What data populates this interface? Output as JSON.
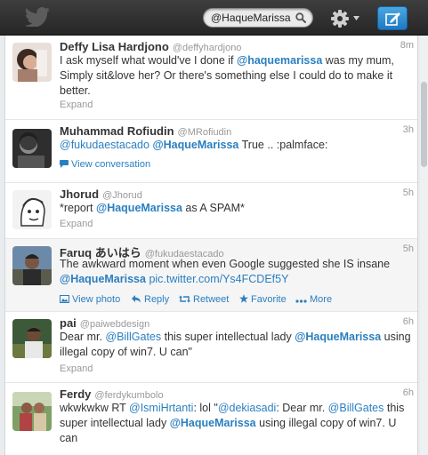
{
  "header": {
    "search_value": "@HaqueMarissa",
    "icons": [
      "twitter-bird-icon",
      "search-icon",
      "gear-icon",
      "compose-icon"
    ]
  },
  "tweets": [
    {
      "name": "Deffy Lisa Hardjono",
      "handle": "@deffyhardjono",
      "time": "8m",
      "text": [
        "I ask myself what would've I done if ",
        "@haquemarissa",
        " was my mum, Simply sit&love her? Or there's something else I could do to make it better."
      ],
      "expand": "Expand"
    },
    {
      "name": "Muhammad Rofiudin",
      "handle": "@MRofiudin",
      "time": "3h",
      "text": [
        "@fukudaestacado",
        " ",
        "@HaqueMarissa",
        " True .. :palmface:"
      ],
      "action": "View conversation"
    },
    {
      "name": "Jhorud",
      "handle": "@Jhorud",
      "time": "5h",
      "text": [
        "*report ",
        "@HaqueMarissa",
        " as A SPAM*"
      ],
      "expand": "Expand"
    },
    {
      "name": "Faruq あいはら",
      "handle": "@fukudaestacado",
      "time": "5h",
      "text": [
        "The awkward moment when even Google suggested she IS insane ",
        "@HaqueMarissa",
        " ",
        "pic.twitter.com/Ys4FCDEf5Y"
      ],
      "actions": [
        "View photo",
        "Reply",
        "Retweet",
        "Favorite",
        "More"
      ]
    },
    {
      "name": "pai",
      "handle": "@paiwebdesign",
      "time": "6h",
      "text": [
        "Dear mr. ",
        "@BillGates",
        " this super intellectual lady ",
        "@HaqueMarissa",
        " using illegal copy of win7. U can\""
      ],
      "expand": "Expand"
    },
    {
      "name": "Ferdy",
      "handle": "@ferdykumbolo",
      "time": "6h",
      "text": [
        "wkwkwkw RT ",
        "@IsmiHrtanti",
        ": lol  \"",
        "@dekiasadi",
        ": Dear mr. ",
        "@BillGates",
        " this super intellectual lady ",
        "@HaqueMarissa",
        " using illegal copy of win7. U can"
      ]
    }
  ]
}
